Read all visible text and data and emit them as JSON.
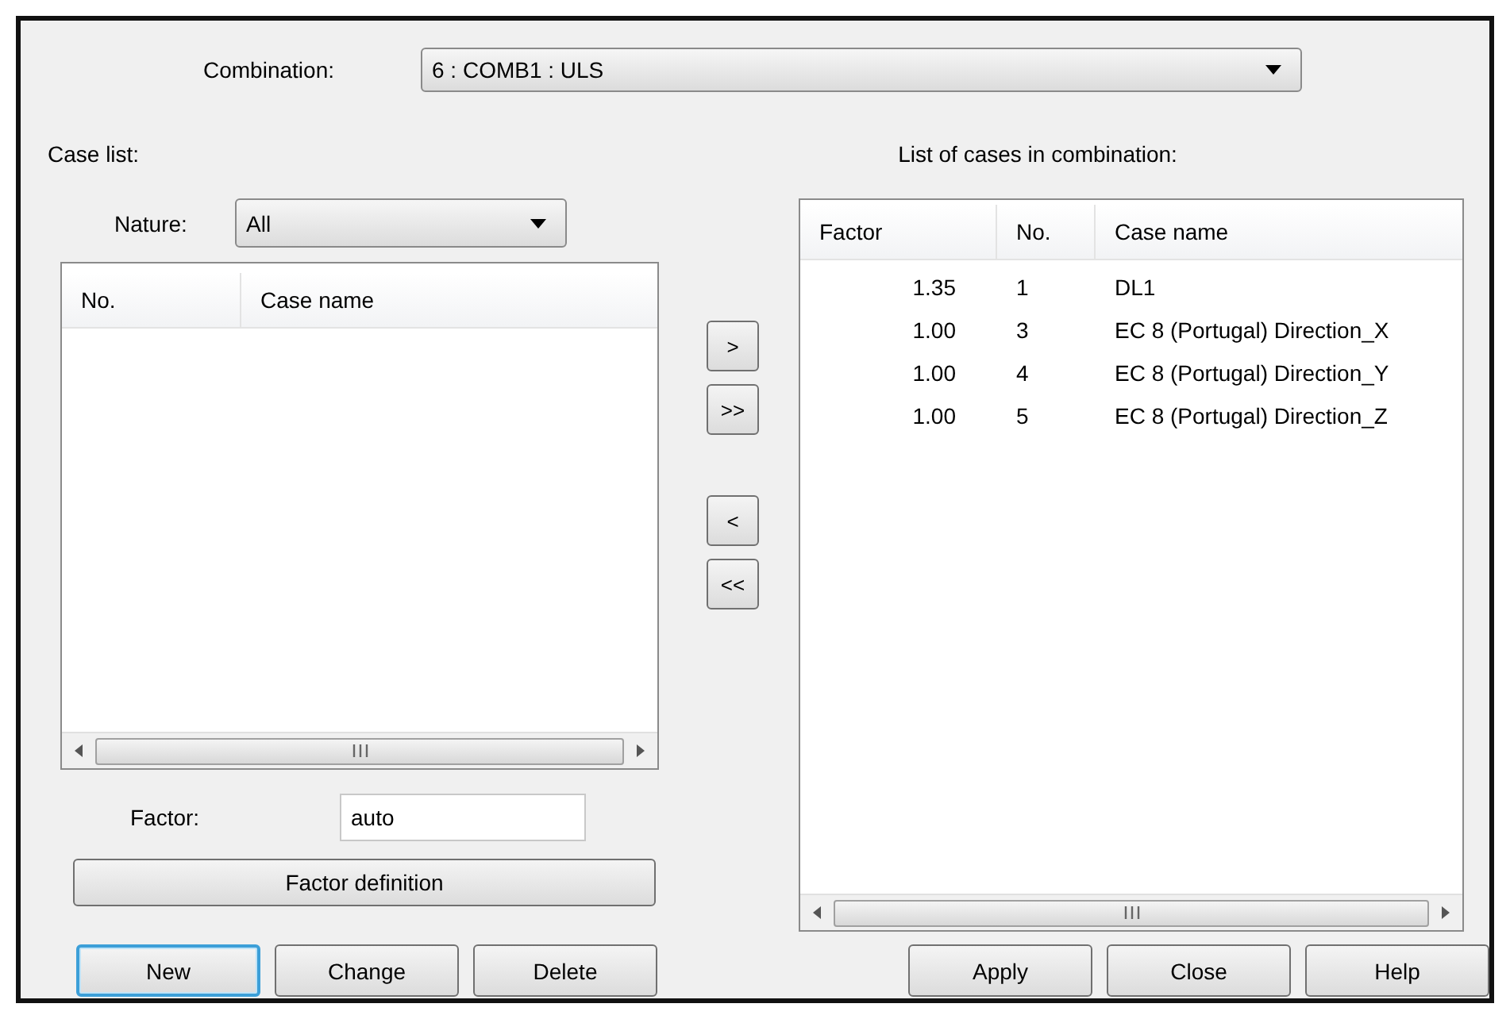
{
  "combination": {
    "label": "Combination:",
    "value": "6 : COMB1 : ULS"
  },
  "case_list": {
    "label": "Case list:",
    "nature": {
      "label": "Nature:",
      "value": "All"
    },
    "columns": [
      "No.",
      "Case name"
    ]
  },
  "transfer_buttons": [
    ">",
    ">>",
    "<",
    "<<"
  ],
  "factor": {
    "label": "Factor:",
    "value": "auto"
  },
  "factor_definition_button": "Factor definition",
  "combination_list": {
    "label": "List of cases in combination:",
    "columns": [
      "Factor",
      "No.",
      "Case name"
    ],
    "rows": [
      {
        "factor": "1.35",
        "no": "1",
        "name": "DL1"
      },
      {
        "factor": "1.00",
        "no": "3",
        "name": "EC 8 (Portugal) Direction_X"
      },
      {
        "factor": "1.00",
        "no": "4",
        "name": "EC 8 (Portugal) Direction_Y"
      },
      {
        "factor": "1.00",
        "no": "5",
        "name": "EC 8 (Portugal) Direction_Z"
      }
    ]
  },
  "left_buttons": [
    {
      "label": "New",
      "focused": true
    },
    {
      "label": "Change",
      "focused": false
    },
    {
      "label": "Delete",
      "focused": false
    }
  ],
  "right_buttons": [
    "Apply",
    "Close",
    "Help"
  ]
}
